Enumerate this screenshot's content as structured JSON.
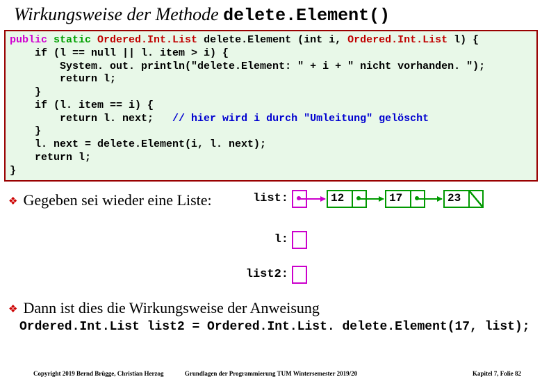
{
  "title_prefix": "Wirkungsweise der Methode ",
  "title_code": "delete.Element()",
  "code": {
    "l1a": "public",
    "l1b": " static",
    "l1c": " Ordered.Int.List",
    "l1d": " delete.Element (int i, ",
    "l1e": "Ordered.Int.List",
    "l1f": " l) {",
    "l2": "    if (l == null || l. item > i) {",
    "l3": "        System. out. println(\"delete.Element: \" + i + \" nicht vorhanden. \");",
    "l4": "        return l;",
    "l5": "    }",
    "l6": "    if (l. item == i) {",
    "l7a": "        return l. next;   ",
    "l7b": "// hier wird i durch \"Umleitung\" gelöscht",
    "l8": "    }",
    "l9": "    l. next = delete.Element(i, l. next);",
    "l10": "    return l;",
    "l11": "}"
  },
  "bullet1": "Gegeben sei wieder eine Liste:",
  "labels": {
    "list": "list:",
    "l": "l:",
    "list2": "list2:"
  },
  "nodes": {
    "n1": "12",
    "n2": "17",
    "n3": "23"
  },
  "bullet2": "Dann ist dies die Wirkungsweise der Anweisung",
  "stmt": "Ordered.Int.List list2 = Ordered.Int.List. delete.Element(17, list);",
  "footer": {
    "left": "Copyright 2019 Bernd Brügge, Christian Herzog",
    "center": "Grundlagen der Programmierung TUM Wintersemester 2019/20",
    "right": "Kapitel 7, Folie 82"
  }
}
